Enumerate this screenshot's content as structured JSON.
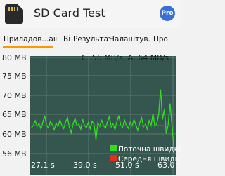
{
  "app": {
    "title": "SD Card Test",
    "pro_badge": "Pro"
  },
  "tabs": [
    {
      "label": "Приладов...ація"
    },
    {
      "label": "Ві"
    },
    {
      "label": "Результат..."
    },
    {
      "label": "Налаштув..."
    },
    {
      "label": "Про"
    }
  ],
  "colors": {
    "chart_background": "#34564e",
    "current_speed": "#33dd22",
    "average_speed": "#e0311e",
    "tab_indicator": "#ff9800"
  },
  "chart_data": {
    "type": "line",
    "title": "C: 56 MB/s, A: 64 MB/s",
    "y_ticks": [
      "80 MB",
      "75 MB",
      "70 MB",
      "65 MB",
      "60 MB",
      "56 MB"
    ],
    "x_ticks": [
      "27.1 s",
      "39.0 s",
      "51.0 s",
      "63.0 s"
    ],
    "ylim": [
      55,
      80
    ],
    "xlim": [
      25.5,
      64
    ],
    "series": [
      {
        "name": "Поточна швидкі",
        "x": [
          26.0,
          26.5,
          27.0,
          27.5,
          28.0,
          28.5,
          29.0,
          29.5,
          30.0,
          30.5,
          31.0,
          31.5,
          32.0,
          32.5,
          33.0,
          33.5,
          34.0,
          34.5,
          35.0,
          35.5,
          36.0,
          36.5,
          37.0,
          37.5,
          38.0,
          38.5,
          39.0,
          39.5,
          40.0,
          40.5,
          41.0,
          41.5,
          42.0,
          42.5,
          43.0,
          43.5,
          44.0,
          44.5,
          45.0,
          45.5,
          46.0,
          46.5,
          47.0,
          47.5,
          48.0,
          48.5,
          49.0,
          49.5,
          50.0,
          50.5,
          51.0,
          51.5,
          52.0,
          52.5,
          53.0,
          53.5,
          54.0,
          54.5,
          55.0,
          55.5,
          56.0,
          56.5,
          57.0,
          57.5,
          58.0,
          58.5,
          59.0,
          59.5,
          60.0,
          60.5,
          61.0,
          61.5,
          62.0,
          62.5,
          63.0,
          63.5
        ],
        "values": [
          62.5,
          63.0,
          64.2,
          62.8,
          63.5,
          62.2,
          63.8,
          65.5,
          63.0,
          62.4,
          64.0,
          63.2,
          62.0,
          63.6,
          62.7,
          64.4,
          63.1,
          62.3,
          63.9,
          65.0,
          62.6,
          61.2,
          63.5,
          64.8,
          62.9,
          63.4,
          62.1,
          64.6,
          63.0,
          62.5,
          63.8,
          62.2,
          64.1,
          63.3,
          59.5,
          63.7,
          62.8,
          64.3,
          63.0,
          62.4,
          63.9,
          65.2,
          62.7,
          63.4,
          62.0,
          64.0,
          65.5,
          63.1,
          62.6,
          64.4,
          63.0,
          62.3,
          63.8,
          62.9,
          64.5,
          63.2,
          61.8,
          63.6,
          64.9,
          62.7,
          63.3,
          62.1,
          64.2,
          63.0,
          66.0,
          62.8,
          63.5,
          65.8,
          72.0,
          64.5,
          67.0,
          61.0,
          63.2,
          68.5,
          63.0,
          57.5
        ]
      },
      {
        "name": "Середня швидкі",
        "x": [
          26.0,
          63.5
        ],
        "values": [
          63.0,
          63.0
        ]
      }
    ],
    "grid": true,
    "legend_position": "bottom-right"
  }
}
